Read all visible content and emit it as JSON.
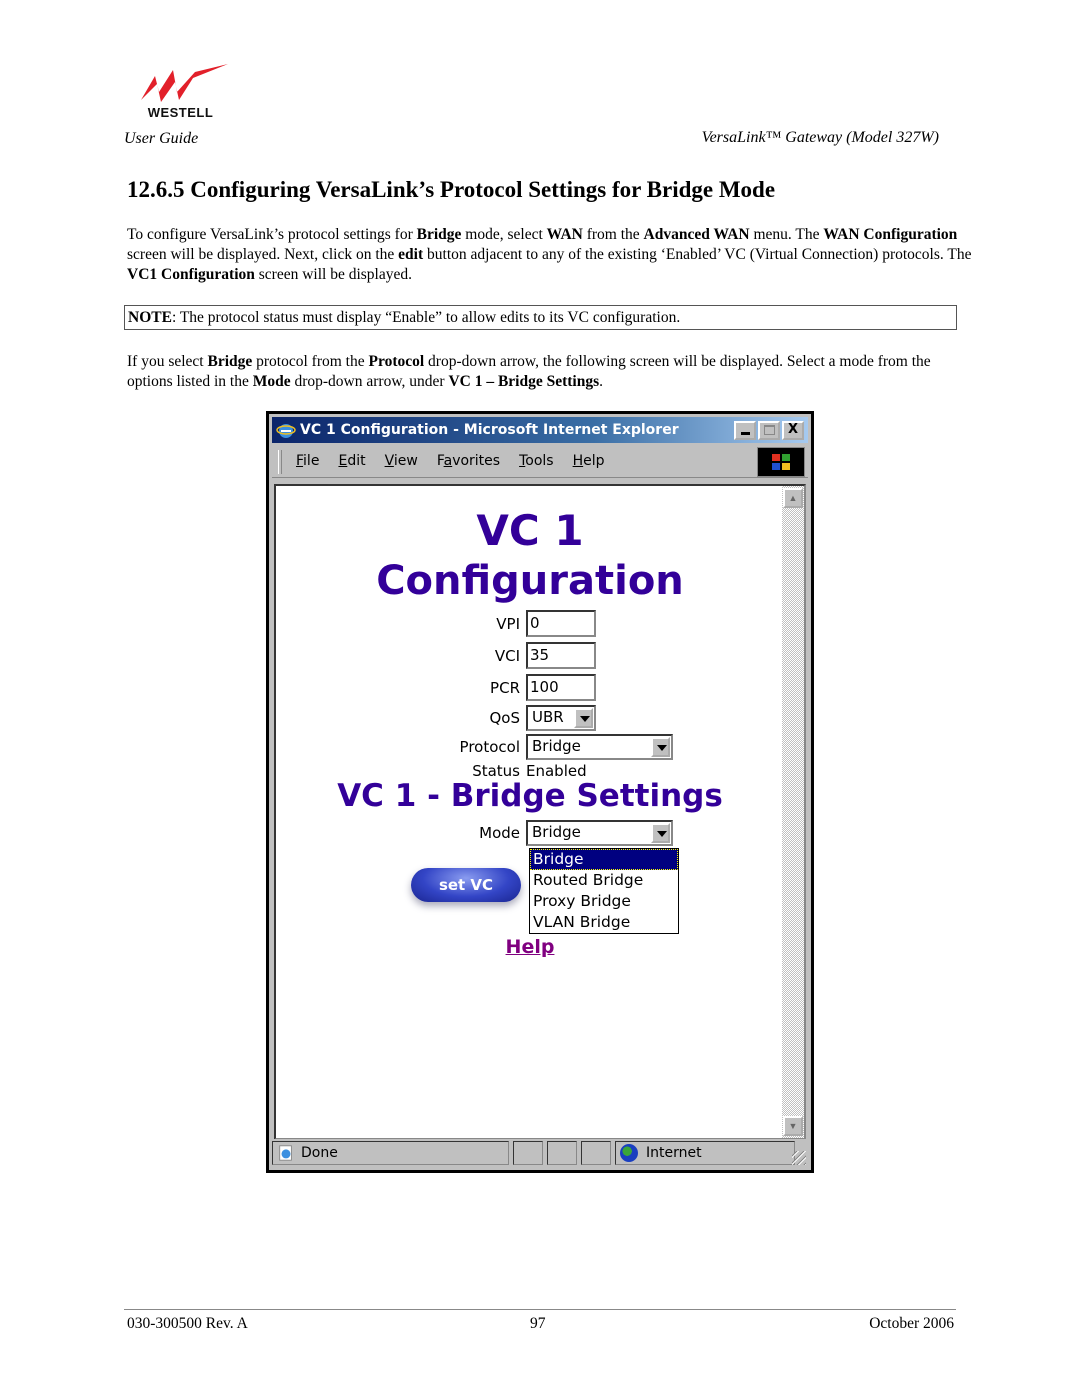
{
  "header": {
    "logo_text": "WESTELL",
    "left": "User Guide",
    "right": "VersaLink™  Gateway (Model 327W)"
  },
  "section": {
    "title": "12.6.5 Configuring VersaLink’s Protocol Settings for Bridge Mode",
    "para1": [
      {
        "t": "To configure VersaLink’s protocol settings for "
      },
      {
        "b": "Bridge"
      },
      {
        "t": " mode, select "
      },
      {
        "b": "WAN"
      },
      {
        "t": " from the "
      },
      {
        "b": "Advanced WAN"
      },
      {
        "t": " menu. The "
      },
      {
        "b": "WAN Configuration"
      },
      {
        "t": " screen will be displayed. Next, click on the "
      },
      {
        "b": "edit"
      },
      {
        "t": " button adjacent to any of the existing ‘Enabled’ VC (Virtual Connection) protocols. The "
      },
      {
        "b": "VC1 Configuration"
      },
      {
        "t": " screen will be displayed."
      }
    ],
    "note": [
      {
        "b": "NOTE"
      },
      {
        "t": ": The protocol status must display “Enable” to allow edits to its VC configuration."
      }
    ],
    "para2": [
      {
        "t": "If you select "
      },
      {
        "b": "Bridge"
      },
      {
        "t": " protocol from the "
      },
      {
        "b": "Protocol"
      },
      {
        "t": " drop-down arrow, the following screen will be displayed. Select a mode from the options listed in the "
      },
      {
        "b": "Mode"
      },
      {
        "t": " drop-down arrow, under "
      },
      {
        "b": "VC 1 – Bridge Settings"
      },
      {
        "t": "."
      }
    ]
  },
  "browser": {
    "title": "VC 1 Configuration - Microsoft Internet Explorer",
    "window_buttons": {
      "minimize": "minimize",
      "maximize": "maximize",
      "close": "X"
    },
    "menus": [
      {
        "ul": "F",
        "rest": "ile"
      },
      {
        "ul": "E",
        "rest": "dit"
      },
      {
        "ul": "V",
        "rest": "iew"
      },
      {
        "pre": "F",
        "ul": "a",
        "rest": "vorites"
      },
      {
        "ul": "T",
        "rest": "ools"
      },
      {
        "ul": "H",
        "rest": "elp"
      }
    ],
    "status": {
      "text": "Done",
      "zone": "Internet"
    }
  },
  "page": {
    "heading1": "VC 1",
    "heading2": "Configuration",
    "fields": {
      "vpi": {
        "label": "VPI",
        "value": "0"
      },
      "vci": {
        "label": "VCI",
        "value": "35"
      },
      "pcr": {
        "label": "PCR",
        "value": "100"
      },
      "qos": {
        "label": "QoS",
        "value": "UBR"
      },
      "protocol": {
        "label": "Protocol",
        "value": "Bridge"
      },
      "status": {
        "label": "Status",
        "value": "Enabled"
      }
    },
    "bridge_heading": "VC 1 - Bridge Settings",
    "mode": {
      "label": "Mode",
      "value": "Bridge",
      "options": [
        "Bridge",
        "Routed Bridge",
        "Proxy Bridge",
        "VLAN Bridge"
      ],
      "highlighted": 0
    },
    "set_button": "set VC",
    "help_link": "Help"
  },
  "footer": {
    "doc": "030-300500 Rev. A",
    "page": "97",
    "date": "October 2006"
  }
}
